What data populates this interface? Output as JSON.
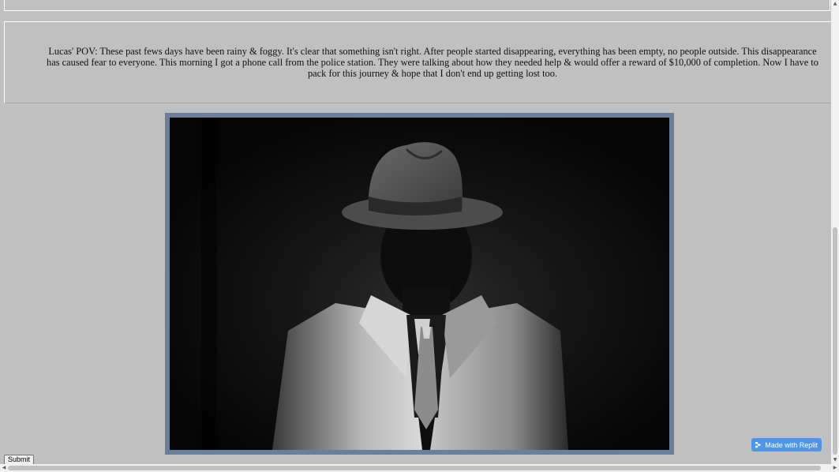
{
  "story": {
    "text": "Lucas' POV: These past fews days have been rainy & foggy. It's clear that something isn't right. After people started disappearing, everything has been empty, no people outside. This disappearance has caused fear to everyone. This morning I got a phone call from the police station. They were talking about how they needed help & would offer a reward of $10,000 of completion. Now I have to pack for this journey & hope that I don't end up getting lost too."
  },
  "image": {
    "subject": "detective-in-fedora-and-trench-coat",
    "frame_color": "#6b7f9a"
  },
  "form": {
    "submit_label": "Submit"
  },
  "badge": {
    "label": "Made with Replit",
    "icon": "replit-icon",
    "color": "#4f96ea"
  },
  "colors": {
    "page_background": "#c0c0c0"
  }
}
